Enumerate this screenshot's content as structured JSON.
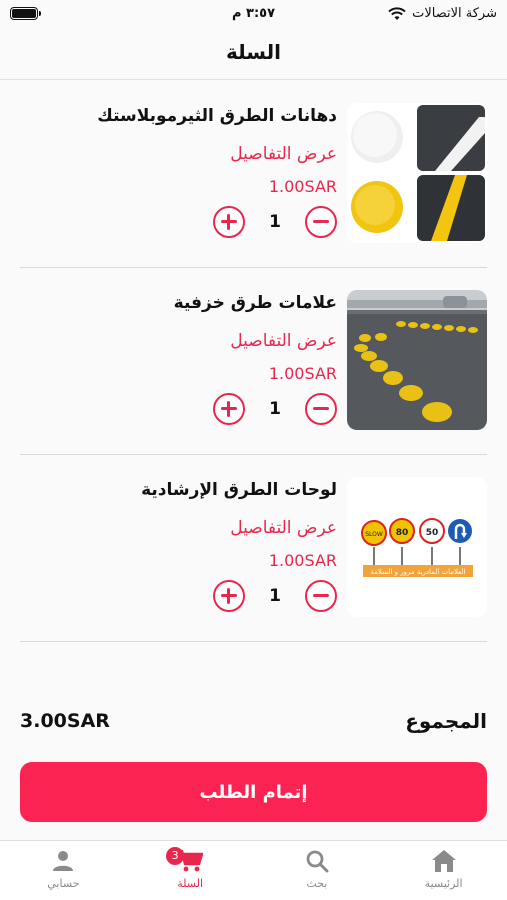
{
  "status_bar": {
    "time": "٣:٥٧ م",
    "carrier": "شركة الاتصالات"
  },
  "header": {
    "title": "السلة"
  },
  "cart": {
    "details_label": "عرض التفاصيل",
    "items": [
      {
        "name": "دهانات الطرق الثيرموبلاستك",
        "price": "1.00SAR",
        "quantity": "1"
      },
      {
        "name": "علامات طرق خزفية",
        "price": "1.00SAR",
        "quantity": "1"
      },
      {
        "name": "لوحات الطرق الإرشادية",
        "price": "1.00SAR",
        "quantity": "1"
      }
    ],
    "sign_caption": "العلامات المادرية مرور و السلامة",
    "sign_values": [
      "SLOW",
      "80",
      "50"
    ]
  },
  "summary": {
    "total_label": "المجموع",
    "total_value": "3.00SAR",
    "checkout_label": "إتمام الطلب"
  },
  "tabbar": {
    "tabs": [
      {
        "label": "الرئيسية",
        "icon": "home-icon"
      },
      {
        "label": "بحث",
        "icon": "search-icon"
      },
      {
        "label": "السلة",
        "icon": "cart-icon",
        "badge": "3",
        "active": true
      },
      {
        "label": "حسابي",
        "icon": "person-icon"
      }
    ]
  },
  "colors": {
    "accent": "#e8274f",
    "button": "#fb2352"
  }
}
